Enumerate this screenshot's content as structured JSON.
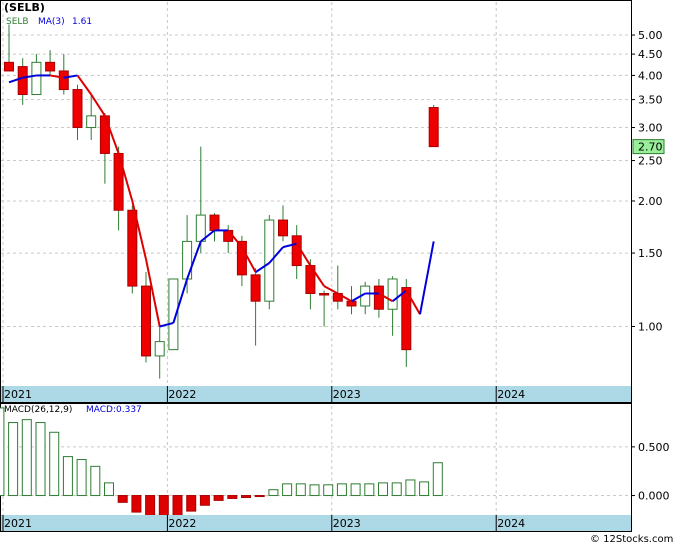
{
  "header": {
    "ticker": "(SELB)"
  },
  "colors": {
    "up_fill": "#ffffff",
    "up_stroke": "#2e7d32",
    "down_fill": "#ee0000",
    "down_stroke": "#aa0000",
    "wick": "#2e7d32",
    "ma_rise": "#0000dd",
    "ma_fall": "#dd0000",
    "axis_band": "#add8e6",
    "last_price_bg": "#99ee99",
    "macd_up_stroke": "#2e7d32",
    "macd_down_fill": "#dd0000",
    "grid": "#c8c8c8"
  },
  "chart_data": [
    {
      "type": "candlestick",
      "name": "price",
      "legend": [
        {
          "text": "SELB",
          "color": "#2e7d32"
        },
        {
          "text": "MA(3)",
          "color": "#0000dd"
        },
        {
          "text": "1.61",
          "color": "#0000dd"
        }
      ],
      "y_scale": "log",
      "ylim": [
        0.72,
        6.0
      ],
      "y_ticks": [
        1.0,
        1.5,
        2.0,
        2.5,
        3.0,
        3.5,
        4.0,
        4.5,
        5.0
      ],
      "y_tick_labels": [
        "1.00",
        "1.50",
        "2.00",
        "2.50",
        "3.00",
        "3.50",
        "4.00",
        "4.50",
        "5.00"
      ],
      "last_price": 2.7,
      "last_price_label": "2.70",
      "x_ticks": [
        {
          "label": "2021",
          "at": 0
        },
        {
          "label": "2022",
          "at": 12
        },
        {
          "label": "2023",
          "at": 24
        },
        {
          "label": "2024",
          "at": 36
        }
      ],
      "candles": [
        {
          "o": 4.3,
          "h": 5.3,
          "l": 4.1,
          "c": 4.1
        },
        {
          "o": 4.2,
          "h": 4.4,
          "l": 3.4,
          "c": 3.6
        },
        {
          "o": 3.6,
          "h": 4.5,
          "l": 3.6,
          "c": 4.3
        },
        {
          "o": 4.3,
          "h": 4.6,
          "l": 4.0,
          "c": 4.1
        },
        {
          "o": 4.1,
          "h": 4.5,
          "l": 3.6,
          "c": 3.7
        },
        {
          "o": 3.7,
          "h": 3.8,
          "l": 2.8,
          "c": 3.0
        },
        {
          "o": 3.0,
          "h": 3.6,
          "l": 2.8,
          "c": 3.2
        },
        {
          "o": 3.2,
          "h": 3.25,
          "l": 2.2,
          "c": 2.6
        },
        {
          "o": 2.6,
          "h": 2.7,
          "l": 1.7,
          "c": 1.9
        },
        {
          "o": 1.9,
          "h": 1.95,
          "l": 1.2,
          "c": 1.25
        },
        {
          "o": 1.25,
          "h": 1.35,
          "l": 0.82,
          "c": 0.85
        },
        {
          "o": 0.85,
          "h": 1.0,
          "l": 0.75,
          "c": 0.92
        },
        {
          "o": 0.88,
          "h": 1.05,
          "l": 0.88,
          "c": 1.3
        },
        {
          "o": 1.3,
          "h": 1.85,
          "l": 1.2,
          "c": 1.6
        },
        {
          "o": 1.6,
          "h": 2.7,
          "l": 1.5,
          "c": 1.85
        },
        {
          "o": 1.85,
          "h": 1.87,
          "l": 1.6,
          "c": 1.7
        },
        {
          "o": 1.7,
          "h": 1.75,
          "l": 1.5,
          "c": 1.6
        },
        {
          "o": 1.6,
          "h": 1.65,
          "l": 1.25,
          "c": 1.33
        },
        {
          "o": 1.33,
          "h": 1.38,
          "l": 0.9,
          "c": 1.15
        },
        {
          "o": 1.15,
          "h": 1.85,
          "l": 1.1,
          "c": 1.8
        },
        {
          "o": 1.8,
          "h": 1.95,
          "l": 1.6,
          "c": 1.65
        },
        {
          "o": 1.65,
          "h": 1.75,
          "l": 1.3,
          "c": 1.4
        },
        {
          "o": 1.4,
          "h": 1.45,
          "l": 1.1,
          "c": 1.2
        },
        {
          "o": 1.2,
          "h": 1.22,
          "l": 1.0,
          "c": 1.19
        },
        {
          "o": 1.2,
          "h": 1.4,
          "l": 1.1,
          "c": 1.15
        },
        {
          "o": 1.15,
          "h": 1.25,
          "l": 1.07,
          "c": 1.12
        },
        {
          "o": 1.12,
          "h": 1.28,
          "l": 1.07,
          "c": 1.25
        },
        {
          "o": 1.25,
          "h": 1.3,
          "l": 1.05,
          "c": 1.1
        },
        {
          "o": 1.1,
          "h": 1.32,
          "l": 0.95,
          "c": 1.3
        },
        {
          "o": 1.24,
          "h": 1.3,
          "l": 0.8,
          "c": 0.88
        },
        {
          "o": 3.35,
          "h": 3.4,
          "l": 2.7,
          "c": 2.7
        }
      ],
      "candle_slots": [
        0,
        1,
        2,
        3,
        4,
        5,
        6,
        7,
        8,
        9,
        10,
        11,
        12,
        13,
        14,
        15,
        16,
        17,
        18,
        19,
        20,
        21,
        22,
        23,
        24,
        25,
        26,
        27,
        28,
        29,
        31
      ],
      "ma3": [
        3.85,
        3.95,
        4.0,
        4.0,
        3.95,
        4.0,
        3.6,
        3.2,
        2.6,
        2.0,
        1.45,
        1.0,
        1.02,
        1.3,
        1.6,
        1.7,
        1.7,
        1.55,
        1.35,
        1.42,
        1.55,
        1.58,
        1.4,
        1.25,
        1.2,
        1.15,
        1.2,
        1.2,
        1.15,
        1.22,
        1.07,
        1.6
      ],
      "ma3_slots": [
        0,
        1,
        2,
        3,
        4,
        5,
        6,
        7,
        8,
        9,
        10,
        11,
        12,
        13,
        14,
        15,
        16,
        17,
        18,
        19,
        20,
        21,
        22,
        23,
        24,
        25,
        26,
        27,
        28,
        29,
        30,
        31
      ]
    },
    {
      "type": "bar",
      "name": "macd",
      "legend": [
        {
          "text": "MACD(26,12,9)",
          "color": "#000000"
        },
        {
          "text": "MACD:0.337",
          "color": "#0000dd"
        }
      ],
      "ylim": [
        -0.2,
        0.92
      ],
      "y_ticks": [
        0.0,
        0.5
      ],
      "y_tick_labels": [
        "0.000",
        "0.500"
      ],
      "x_ticks": [
        {
          "label": "2021",
          "at": 0
        },
        {
          "label": "2022",
          "at": 12
        },
        {
          "label": "2023",
          "at": 24
        },
        {
          "label": "2024",
          "at": 36
        }
      ],
      "values": [
        0.9,
        0.75,
        0.78,
        0.75,
        0.65,
        0.4,
        0.37,
        0.3,
        0.13,
        -0.07,
        -0.17,
        -0.27,
        -0.27,
        -0.22,
        -0.16,
        -0.1,
        -0.05,
        -0.03,
        -0.02,
        -0.01,
        0.06,
        0.12,
        0.12,
        0.11,
        0.11,
        0.12,
        0.12,
        0.12,
        0.13,
        0.13,
        0.16,
        0.14,
        0.337
      ],
      "slots": [
        -0.7,
        0.3,
        1.3,
        2.3,
        3.3,
        4.3,
        5.3,
        6.3,
        7.3,
        8.3,
        9.3,
        10.3,
        11.3,
        12.3,
        13.3,
        14.3,
        15.3,
        16.3,
        17.3,
        18.3,
        19.3,
        20.3,
        21.3,
        22.3,
        23.3,
        24.3,
        25.3,
        26.3,
        27.3,
        28.3,
        29.3,
        30.3,
        31.3
      ]
    }
  ],
  "footer": {
    "credit": "© 12Stocks.com"
  }
}
